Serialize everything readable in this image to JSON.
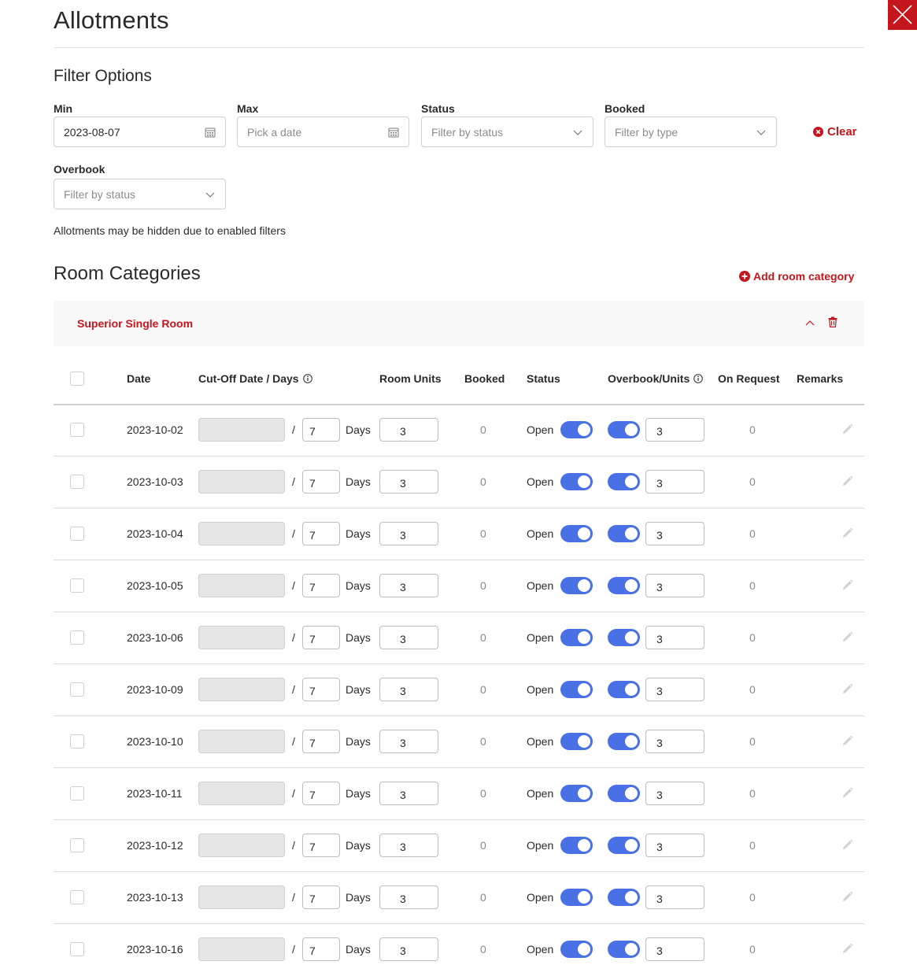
{
  "header": {
    "title": "Allotments",
    "accent_color": "#c4161c",
    "close_icon": "close-icon"
  },
  "filters": {
    "title": "Filter Options",
    "min": {
      "label": "Min",
      "value": "2023-08-07"
    },
    "max": {
      "label": "Max",
      "placeholder": "Pick a date"
    },
    "status": {
      "label": "Status",
      "placeholder": "Filter by status"
    },
    "booked": {
      "label": "Booked",
      "placeholder": "Filter by type"
    },
    "overbook": {
      "label": "Overbook",
      "placeholder": "Filter by status"
    },
    "clear_label": "Clear",
    "hint": "Allotments may be hidden due to enabled filters"
  },
  "room_categories": {
    "title": "Room Categories",
    "add_label": "Add room category",
    "category": {
      "name": "Superior Single Room",
      "expanded": true
    }
  },
  "table": {
    "columns": {
      "date": "Date",
      "cutoff": "Cut-Off Date / Days",
      "room_units": "Room Units",
      "booked": "Booked",
      "status": "Status",
      "overbook": "Overbook/Units",
      "on_request": "On Request",
      "remarks": "Remarks"
    },
    "separator": "/",
    "days_label": "Days",
    "toggle_color": "#4a70e6",
    "rows": [
      {
        "date": "2023-10-02",
        "cutoff_days": "7",
        "room_units": "3",
        "booked": "0",
        "status": "Open",
        "status_on": true,
        "overbook_on": true,
        "overbook_units": "3",
        "on_request": "0"
      },
      {
        "date": "2023-10-03",
        "cutoff_days": "7",
        "room_units": "3",
        "booked": "0",
        "status": "Open",
        "status_on": true,
        "overbook_on": true,
        "overbook_units": "3",
        "on_request": "0"
      },
      {
        "date": "2023-10-04",
        "cutoff_days": "7",
        "room_units": "3",
        "booked": "0",
        "status": "Open",
        "status_on": true,
        "overbook_on": true,
        "overbook_units": "3",
        "on_request": "0"
      },
      {
        "date": "2023-10-05",
        "cutoff_days": "7",
        "room_units": "3",
        "booked": "0",
        "status": "Open",
        "status_on": true,
        "overbook_on": true,
        "overbook_units": "3",
        "on_request": "0"
      },
      {
        "date": "2023-10-06",
        "cutoff_days": "7",
        "room_units": "3",
        "booked": "0",
        "status": "Open",
        "status_on": true,
        "overbook_on": true,
        "overbook_units": "3",
        "on_request": "0"
      },
      {
        "date": "2023-10-09",
        "cutoff_days": "7",
        "room_units": "3",
        "booked": "0",
        "status": "Open",
        "status_on": true,
        "overbook_on": true,
        "overbook_units": "3",
        "on_request": "0"
      },
      {
        "date": "2023-10-10",
        "cutoff_days": "7",
        "room_units": "3",
        "booked": "0",
        "status": "Open",
        "status_on": true,
        "overbook_on": true,
        "overbook_units": "3",
        "on_request": "0"
      },
      {
        "date": "2023-10-11",
        "cutoff_days": "7",
        "room_units": "3",
        "booked": "0",
        "status": "Open",
        "status_on": true,
        "overbook_on": true,
        "overbook_units": "3",
        "on_request": "0"
      },
      {
        "date": "2023-10-12",
        "cutoff_days": "7",
        "room_units": "3",
        "booked": "0",
        "status": "Open",
        "status_on": true,
        "overbook_on": true,
        "overbook_units": "3",
        "on_request": "0"
      },
      {
        "date": "2023-10-13",
        "cutoff_days": "7",
        "room_units": "3",
        "booked": "0",
        "status": "Open",
        "status_on": true,
        "overbook_on": true,
        "overbook_units": "3",
        "on_request": "0"
      },
      {
        "date": "2023-10-16",
        "cutoff_days": "7",
        "room_units": "3",
        "booked": "0",
        "status": "Open",
        "status_on": true,
        "overbook_on": true,
        "overbook_units": "3",
        "on_request": "0"
      }
    ]
  }
}
